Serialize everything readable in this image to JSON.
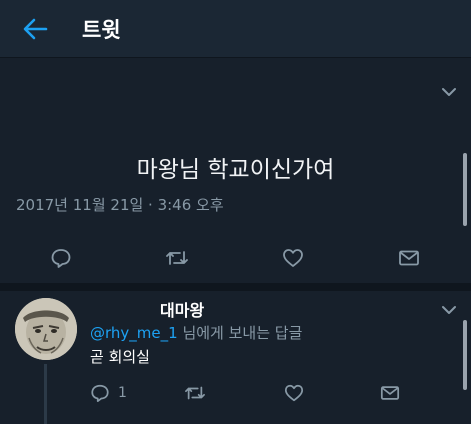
{
  "header": {
    "title": "트윗"
  },
  "tweet": {
    "text": "마왕님 학교이신가여",
    "timestamp": "2017년 11월 21일 · 3:46 오후",
    "actions": [
      "reply",
      "retweet",
      "like",
      "message"
    ]
  },
  "reply": {
    "display_name": "대마왕",
    "mention": "@rhy_me_1",
    "replying_to_suffix": " 님에게 보내는 답글",
    "text": "곧 회의실",
    "reply_count": "1"
  },
  "colors": {
    "background": "#17202b",
    "header": "#1b2734",
    "accent": "#1da1f2",
    "muted": "#8899a6"
  }
}
